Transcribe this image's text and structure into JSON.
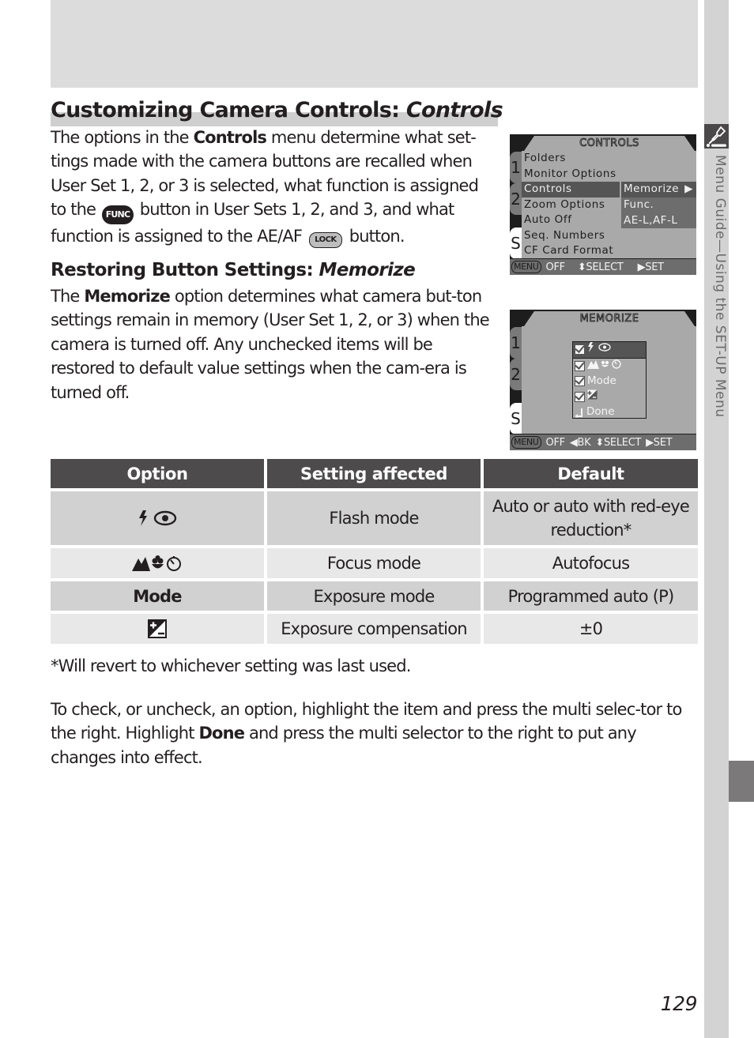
{
  "page": {
    "number": "129",
    "side_label": "Menu Guide—Using the SET-UP Menu",
    "side_icon": "setup-wrench-icon"
  },
  "section1": {
    "heading_plain": "Customizing Camera Controls: ",
    "heading_italic": "Controls",
    "para": [
      {
        "t": "The options in the "
      },
      {
        "t": "Controls",
        "b": true
      },
      {
        "t": " menu determine what set-tings made with the camera buttons are recalled when User Set 1, 2, or 3 is selected, what function is assigned to the "
      },
      {
        "icon": "func-button",
        "label": "FUNC"
      },
      {
        "t": " button in User Sets 1, 2, and 3, and what function is assigned to the AE/AF "
      },
      {
        "icon": "lock-button",
        "label": "LOCK"
      },
      {
        "t": " button."
      }
    ]
  },
  "section2": {
    "heading_plain": "Restoring Button Settings: ",
    "heading_italic": "Memorize",
    "para": [
      {
        "t": "The "
      },
      {
        "t": "Memorize",
        "b": true
      },
      {
        "t": " option determines what camera but-ton settings remain in memory (User Set 1, 2, or 3) when the camera is turned off. Any unchecked items will be restored to default value settings when the cam-era is turned off."
      }
    ]
  },
  "lcd_controls": {
    "title": "CONTROLS",
    "tabs": [
      "1",
      "2",
      "S"
    ],
    "items": [
      "Folders",
      "Monitor Options",
      "Controls",
      "Zoom Options",
      "Auto Off",
      "Seq. Numbers",
      "CF Card Format"
    ],
    "selected_index": 2,
    "submenu": [
      "Memorize",
      "Func.",
      "AE-L,AF-L"
    ],
    "footer": {
      "menu": "MENU",
      "off": "OFF",
      "select": "⬍SELECT",
      "set": "▶SET"
    }
  },
  "lcd_memorize": {
    "title": "MEMORIZE",
    "tabs": [
      "1",
      "2",
      "S"
    ],
    "rows": [
      {
        "checked": true,
        "label": "ϟ ◉",
        "icon": "flash-redeye-icon"
      },
      {
        "checked": true,
        "label": "▲❀◷",
        "icon": "focus-icons"
      },
      {
        "checked": true,
        "label": "Mode"
      },
      {
        "checked": true,
        "label": "±",
        "icon": "exposure-comp-icon"
      },
      {
        "checked": false,
        "label": "Done",
        "icon": "return-icon"
      }
    ],
    "footer": {
      "menu": "MENU",
      "off": "OFF",
      "back": "◀BK",
      "select": "⬍SELECT",
      "set": "▶SET"
    }
  },
  "table": {
    "headers": [
      "Option",
      "Setting affected",
      "Default"
    ],
    "rows": [
      {
        "option_icon": "flash-redeye-icon",
        "option": "",
        "setting": "Flash mode",
        "default": "Auto or auto with red-eye reduction*"
      },
      {
        "option_icon": "focus-mode-icons",
        "option": "",
        "setting": "Focus mode",
        "default": "Autofocus"
      },
      {
        "option_icon": "",
        "option": "Mode",
        "setting": "Exposure mode",
        "default": "Programmed auto (P)"
      },
      {
        "option_icon": "exposure-comp-icon",
        "option": "",
        "setting": "Exposure compensation",
        "default": "±0"
      }
    ]
  },
  "footnote": "*Will revert to whichever setting was last used.",
  "closing_para": [
    {
      "t": "To check, or uncheck, an option, highlight the item and press the multi selec-tor to the right. Highlight "
    },
    {
      "t": "Done",
      "b": true
    },
    {
      "t": " and press the multi selector to the right to put any changes into effect."
    }
  ]
}
